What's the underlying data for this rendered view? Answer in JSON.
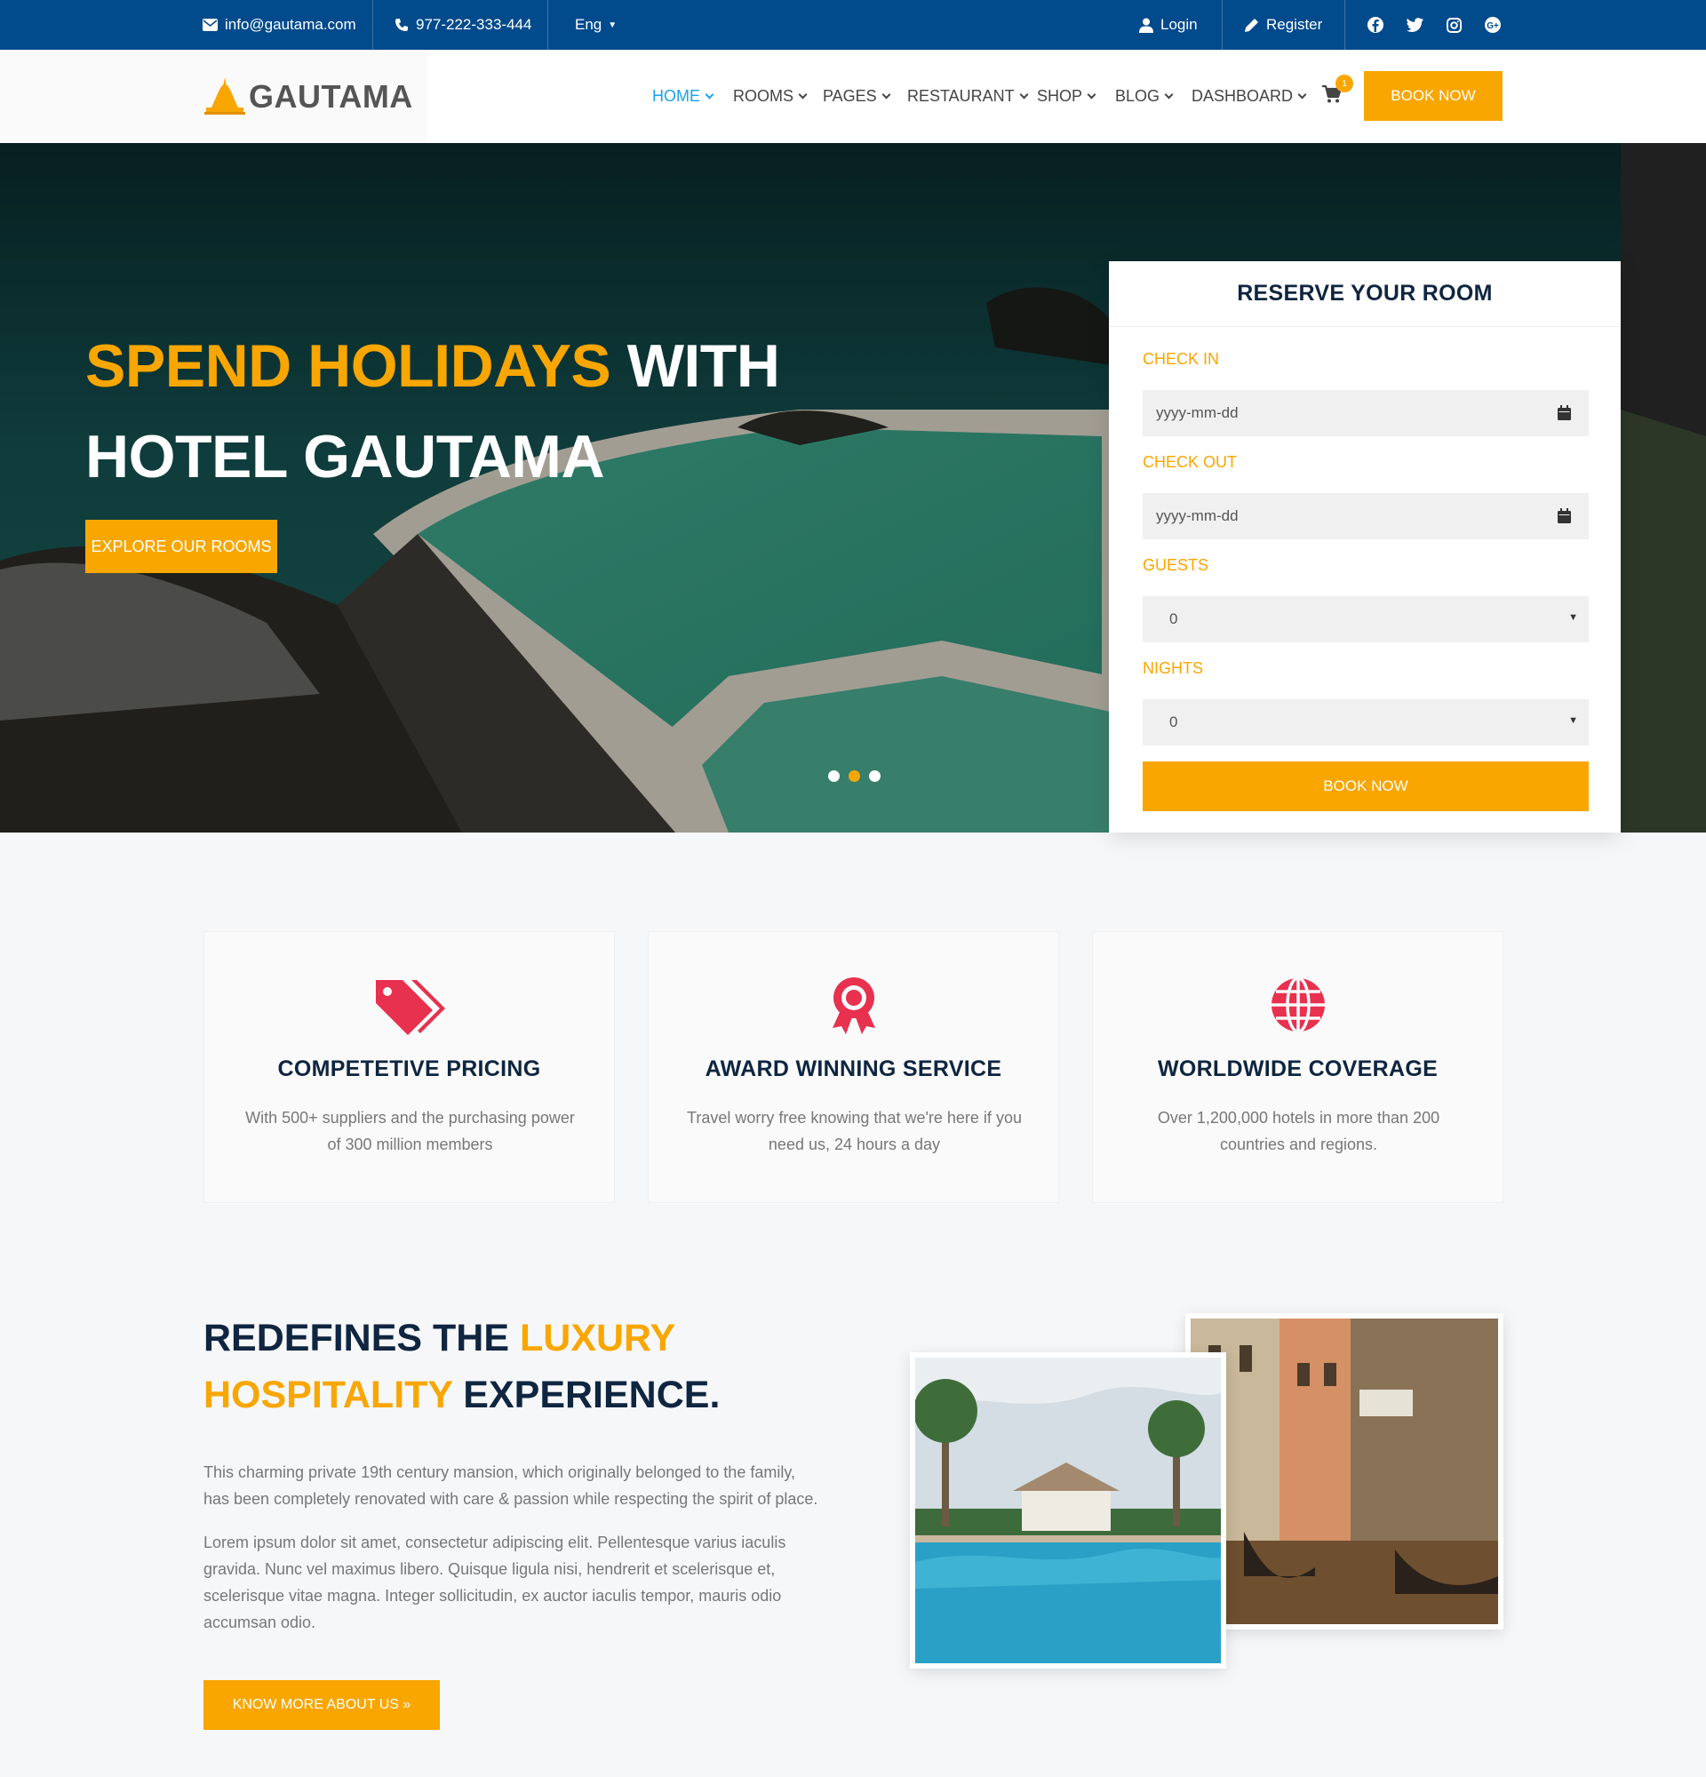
{
  "topbar": {
    "email": "info@gautama.com",
    "phone": "977-222-333-444",
    "language": "Eng",
    "login": "Login",
    "register": "Register",
    "social_icons": [
      "facebook-icon",
      "twitter-icon",
      "instagram-icon",
      "google-plus-icon"
    ]
  },
  "header": {
    "logo_text": "GAUTAMA",
    "nav": [
      {
        "label": "HOME",
        "active": true
      },
      {
        "label": "ROOMS"
      },
      {
        "label": "PAGES"
      },
      {
        "label": "RESTAURANT"
      },
      {
        "label": "SHOP"
      },
      {
        "label": "BLOG"
      },
      {
        "label": "DASHBOARD"
      }
    ],
    "cart_count": "1",
    "book_now": "BOOK NOW"
  },
  "hero": {
    "title_accent": "SPEND HOLIDAYS",
    "title_rest": "WITH",
    "title_line2": "HOTEL GAUTAMA",
    "explore_button": "EXPLORE OUR ROOMS",
    "slides": 3,
    "active_slide": 2
  },
  "reserve": {
    "title": "RESERVE YOUR ROOM",
    "check_in_label": "CHECK IN",
    "check_in_placeholder": "yyyy-mm-dd",
    "check_out_label": "CHECK OUT",
    "check_out_placeholder": "yyyy-mm-dd",
    "guests_label": "GUESTS",
    "guests_value": "0",
    "nights_label": "NIGHTS",
    "nights_value": "0",
    "book_button": "BOOK NOW"
  },
  "features": [
    {
      "icon": "price-tags-icon",
      "title": "COMPETETIVE PRICING",
      "text": "With 500+ suppliers and the purchasing power of 300 million members"
    },
    {
      "icon": "award-ribbon-icon",
      "title": "AWARD WINNING SERVICE",
      "text": "Travel worry free knowing that we're here if you need us, 24 hours a day"
    },
    {
      "icon": "globe-icon",
      "title": "WORLDWIDE COVERAGE",
      "text": "Over 1,200,000 hotels in more than 200 countries and regions."
    }
  ],
  "about": {
    "title_part1": "REDEFINES THE",
    "title_accent1": "LUXURY",
    "title_accent2": "HOSPITALITY",
    "title_part2": "EXPERIENCE.",
    "paragraph1": "This charming private 19th century mansion, which originally belonged to the family, has been completely renovated with care & passion while respecting the spirit of place.",
    "paragraph2": "Lorem ipsum dolor sit amet, consectetur adipiscing elit. Pellentesque varius iaculis gravida. Nunc vel maximus libero. Quisque ligula nisi, hendrerit et scelerisque et, scelerisque vitae magna. Integer sollicitudin, ex auctor iaculis tempor, mauris odio accumsan odio.",
    "button": "KNOW MORE ABOUT US »"
  },
  "colors": {
    "topbar": "#014a8c",
    "accent": "#f9a600",
    "nav_active": "#1aa3e8",
    "heading": "#0f2540",
    "feature_icon": "#e8314f"
  }
}
